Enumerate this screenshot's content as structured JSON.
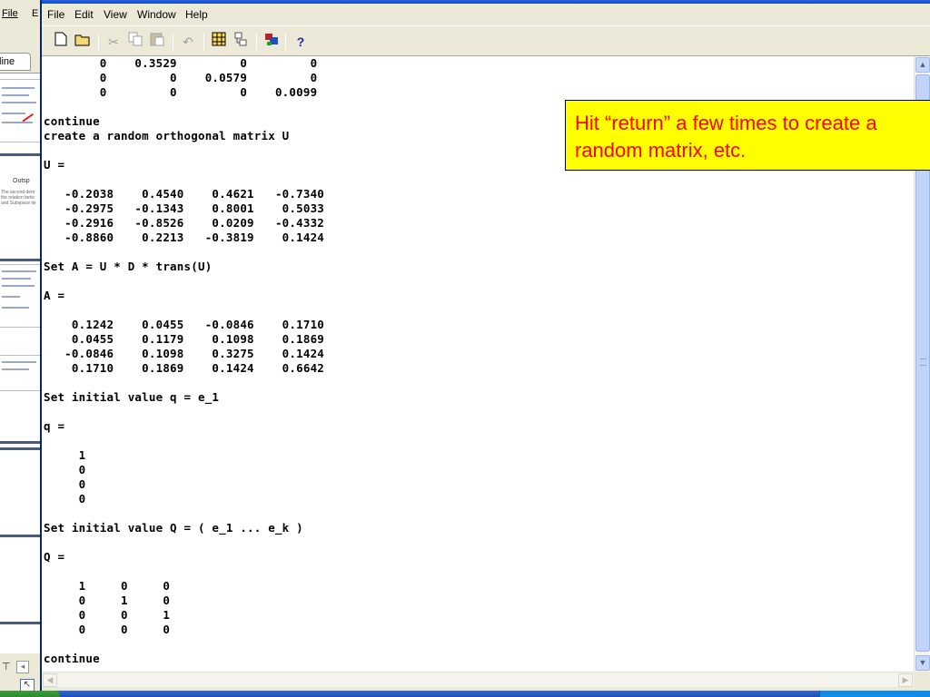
{
  "background_window": {
    "menu_file": "File",
    "menu_edit": "E",
    "outline_tab": "line",
    "thumb_title": "Outsp",
    "thumb_text": "The second dem\nthe relation betw\nand Subspace ite"
  },
  "menubar": {
    "items": [
      "File",
      "Edit",
      "View",
      "Window",
      "Help"
    ]
  },
  "toolbar": {
    "icons": [
      "new-document-icon",
      "open-folder-icon",
      "cut-icon",
      "copy-icon",
      "paste-icon",
      "undo-icon",
      "workspace-icon",
      "path-browser-icon",
      "simulink-icon",
      "help-icon"
    ],
    "help_glyph": "?"
  },
  "console": {
    "lines": [
      "        0    0.3529         0         0",
      "        0         0    0.0579         0",
      "        0         0         0    0.0099",
      "",
      "continue",
      "create a random orthogonal matrix U",
      "",
      "U =",
      "",
      "   -0.2038    0.4540    0.4621   -0.7340",
      "   -0.2975   -0.1343    0.8001    0.5033",
      "   -0.2916   -0.8526    0.0209   -0.4332",
      "   -0.8860    0.2213   -0.3819    0.1424",
      "",
      "Set A = U * D * trans(U)",
      "",
      "A =",
      "",
      "    0.1242    0.0455   -0.0846    0.1710",
      "    0.0455    0.1179    0.1098    0.1869",
      "   -0.0846    0.1098    0.3275    0.1424",
      "    0.1710    0.1869    0.1424    0.6642",
      "",
      "Set initial value q = e_1",
      "",
      "q =",
      "",
      "     1",
      "     0",
      "     0",
      "     0",
      "",
      "Set initial value Q = ( e_1 ... e_k )",
      "",
      "Q =",
      "",
      "     1     0     0",
      "     0     1     0",
      "     0     0     1",
      "     0     0     0",
      "",
      "continue"
    ]
  },
  "callout": {
    "text": "Hit “return” a few times to create a random matrix, etc."
  },
  "colors": {
    "callout_bg": "#ffff00",
    "callout_text": "#ff0000",
    "titlebar": "#0b4bc8"
  }
}
